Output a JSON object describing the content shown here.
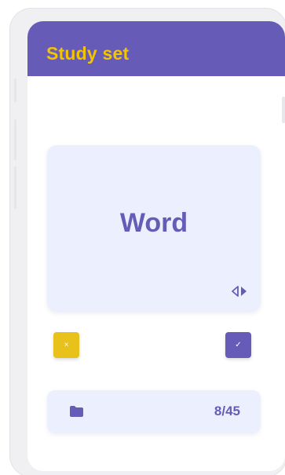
{
  "app": {
    "title": "Study set"
  },
  "card": {
    "word": "Word",
    "flip_icon": "flip-arrows-icon"
  },
  "actions": {
    "wrong_glyph": "×",
    "right_glyph": "✓",
    "wrong_icon": "close-icon",
    "right_icon": "check-icon"
  },
  "footer": {
    "folder_icon": "folder-icon",
    "progress": "8/45"
  },
  "colors": {
    "primary": "#665cb8",
    "accent": "#f3c400",
    "card_background": "#ecf0fe"
  }
}
